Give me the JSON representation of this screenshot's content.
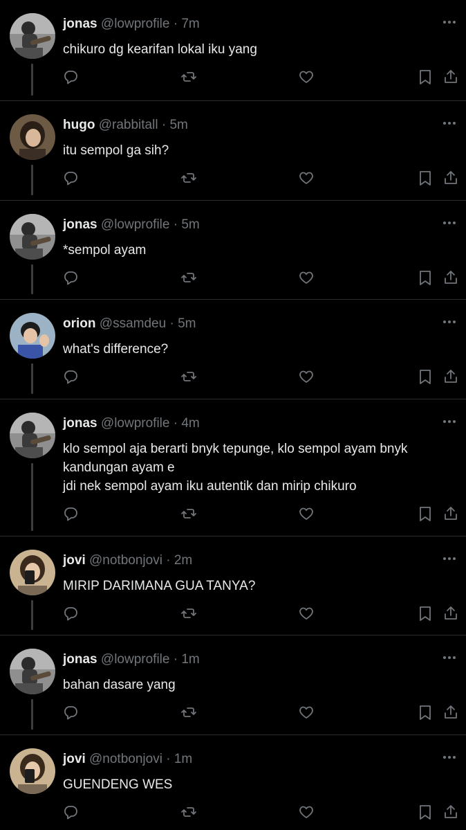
{
  "colors": {
    "background": "#000000",
    "text": "#e7e9ea",
    "muted": "#71767b",
    "divider": "#2a2d31",
    "thread": "#3a3d41"
  },
  "icons": {
    "reply": "reply-icon",
    "retweet": "retweet-icon",
    "like": "heart-icon",
    "bookmark": "bookmark-icon",
    "share": "share-icon",
    "more": "more-icon"
  },
  "tweets": [
    {
      "name": "jonas",
      "handle": "@lowprofile",
      "time": "7m",
      "sep": "·",
      "text": "chikuro dg kearifan lokal iku yang"
    },
    {
      "name": "hugo",
      "handle": "@rabbitall",
      "time": "5m",
      "sep": "·",
      "text": "itu sempol ga sih?"
    },
    {
      "name": "jonas",
      "handle": "@lowprofile",
      "time": "5m",
      "sep": "·",
      "text": "*sempol ayam"
    },
    {
      "name": "orion",
      "handle": "@ssamdeu",
      "time": "5m",
      "sep": "·",
      "text": "what's difference?"
    },
    {
      "name": "jonas",
      "handle": "@lowprofile",
      "time": "4m",
      "sep": "·",
      "text": "klo sempol aja berarti bnyk tepunge, klo sempol ayam bnyk\nkandungan ayam e\njdi nek sempol ayam iku autentik dan mirip chikuro"
    },
    {
      "name": "jovi",
      "handle": "@notbonjovi",
      "time": "2m",
      "sep": "·",
      "text": "MIRIP DARIMANA GUA TANYA?"
    },
    {
      "name": "jonas",
      "handle": "@lowprofile",
      "time": "1m",
      "sep": "·",
      "text": "bahan dasare yang"
    },
    {
      "name": "jovi",
      "handle": "@notbonjovi",
      "time": "1m",
      "sep": "·",
      "text": "GUENDENG WES"
    }
  ]
}
